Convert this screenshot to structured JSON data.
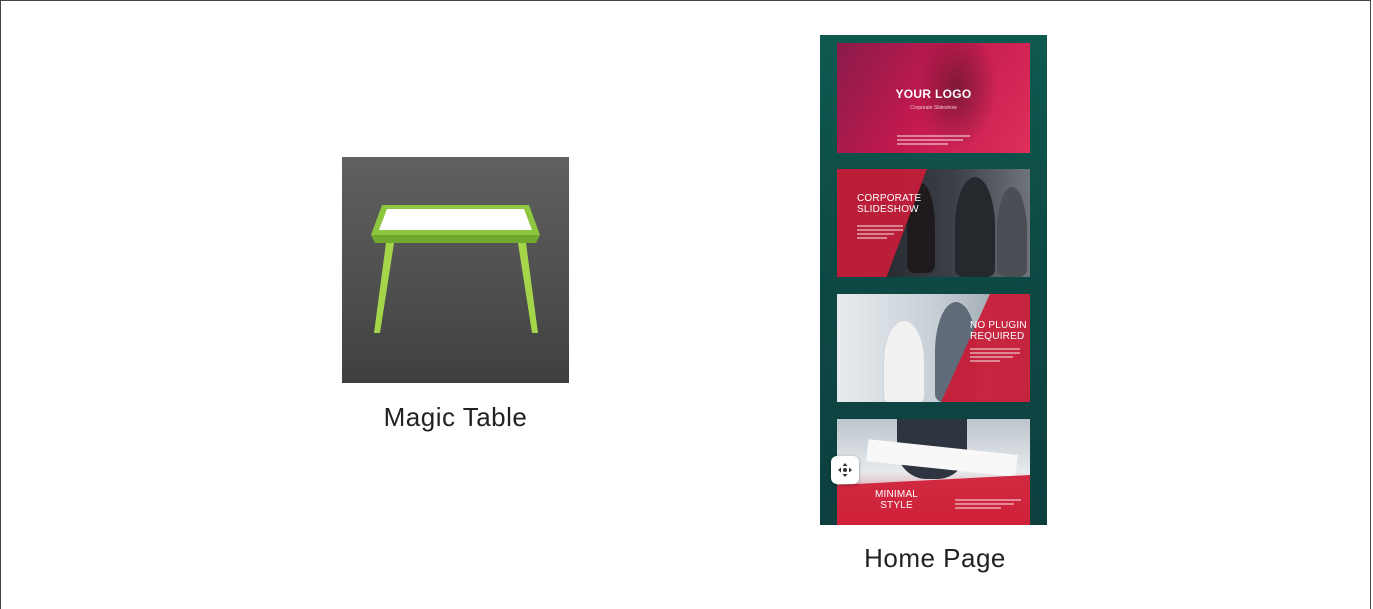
{
  "items": [
    {
      "caption": "Magic Table",
      "icon": "table-icon",
      "accent": "#8dc63f"
    },
    {
      "caption": "Home Page",
      "slides": [
        {
          "title": "YOUR LOGO",
          "subtitle": "Corporate Slideshow"
        },
        {
          "title_line1": "CORPORATE",
          "title_line2": "SLIDESHOW"
        },
        {
          "title_line1": "NO PLUGIN",
          "title_line2": "REQUIRED"
        },
        {
          "title_line1": "MINIMAL",
          "title_line2": "STYLE"
        }
      ],
      "move_icon": "move-icon",
      "accent": "#d51f3f",
      "background": "#0d4a44"
    }
  ]
}
